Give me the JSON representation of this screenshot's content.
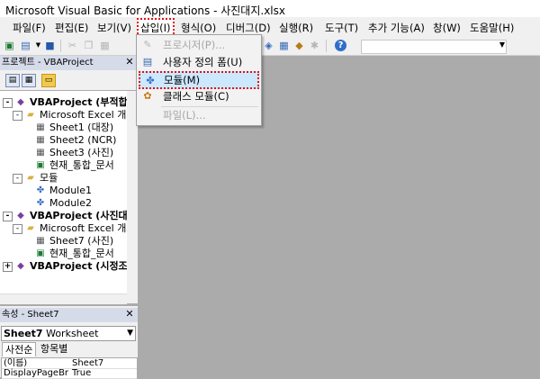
{
  "window": {
    "title": "Microsoft Visual Basic for Applications - 사진대지.xlsx"
  },
  "menubar": [
    {
      "label": "파일(F)"
    },
    {
      "label": "편집(E)"
    },
    {
      "label": "보기(V)"
    },
    {
      "label": "삽입(I)"
    },
    {
      "label": "형식(O)"
    },
    {
      "label": "디버그(D)"
    },
    {
      "label": "실행(R)"
    },
    {
      "label": "도구(T)"
    },
    {
      "label": "추가 기능(A)"
    },
    {
      "label": "창(W)"
    },
    {
      "label": "도움말(H)"
    }
  ],
  "insert_menu": {
    "items": [
      {
        "label": "프로시저(P)...",
        "icon": "procedure-icon",
        "enabled": false
      },
      {
        "label": "사용자 정의 폼(U)",
        "icon": "userform-icon",
        "enabled": true
      },
      {
        "label": "모듈(M)",
        "icon": "module-icon",
        "enabled": true,
        "highlighted": true
      },
      {
        "label": "클래스 모듈(C)",
        "icon": "class-module-icon",
        "enabled": true
      },
      {
        "label": "파일(L)...",
        "icon": "",
        "enabled": false
      }
    ]
  },
  "project_panel": {
    "title": "프로젝트 - VBAProject",
    "tree": [
      {
        "label": "VBAProject (부적합보",
        "icon": "vba-project-icon",
        "expander": "-",
        "bold": true,
        "level": 0
      },
      {
        "label": "Microsoft Excel 개체",
        "icon": "folder-icon",
        "expander": "-",
        "level": 1
      },
      {
        "label": "Sheet1 (대장)",
        "icon": "sheet-icon",
        "level": 2
      },
      {
        "label": "Sheet2 (NCR)",
        "icon": "sheet-icon",
        "level": 2
      },
      {
        "label": "Sheet3 (사진)",
        "icon": "sheet-icon",
        "level": 2
      },
      {
        "label": "현재_통합_문서",
        "icon": "workbook-icon",
        "level": 2
      },
      {
        "label": "모듈",
        "icon": "folder-icon",
        "expander": "-",
        "level": 1
      },
      {
        "label": "Module1",
        "icon": "module-icon",
        "level": 2
      },
      {
        "label": "Module2",
        "icon": "module-icon",
        "level": 2
      },
      {
        "label": "VBAProject (사진대지",
        "icon": "vba-project-icon",
        "expander": "-",
        "bold": true,
        "level": 0
      },
      {
        "label": "Microsoft Excel 개체",
        "icon": "folder-icon",
        "expander": "-",
        "level": 1
      },
      {
        "label": "Sheet7 (사진)",
        "icon": "sheet-icon",
        "level": 2
      },
      {
        "label": "현재_통합_문서",
        "icon": "workbook-icon",
        "level": 2
      },
      {
        "label": "VBAProject (시정조치",
        "icon": "vba-project-icon",
        "expander": "+",
        "bold": true,
        "level": 0
      }
    ]
  },
  "properties_panel": {
    "title": "속성 - Sheet7",
    "object_name": "Sheet7",
    "object_type": "Worksheet",
    "tabs": [
      {
        "label": "사전순",
        "selected": true
      },
      {
        "label": "항목별",
        "selected": false
      }
    ],
    "rows": [
      {
        "name": "(이름)",
        "value": "Sheet7"
      },
      {
        "name": "DisplayPageBr",
        "value": "True"
      }
    ]
  },
  "colors": {
    "highlight_border": "#e0101a",
    "selection": "#cce8ff",
    "code_area": "#ababab"
  }
}
